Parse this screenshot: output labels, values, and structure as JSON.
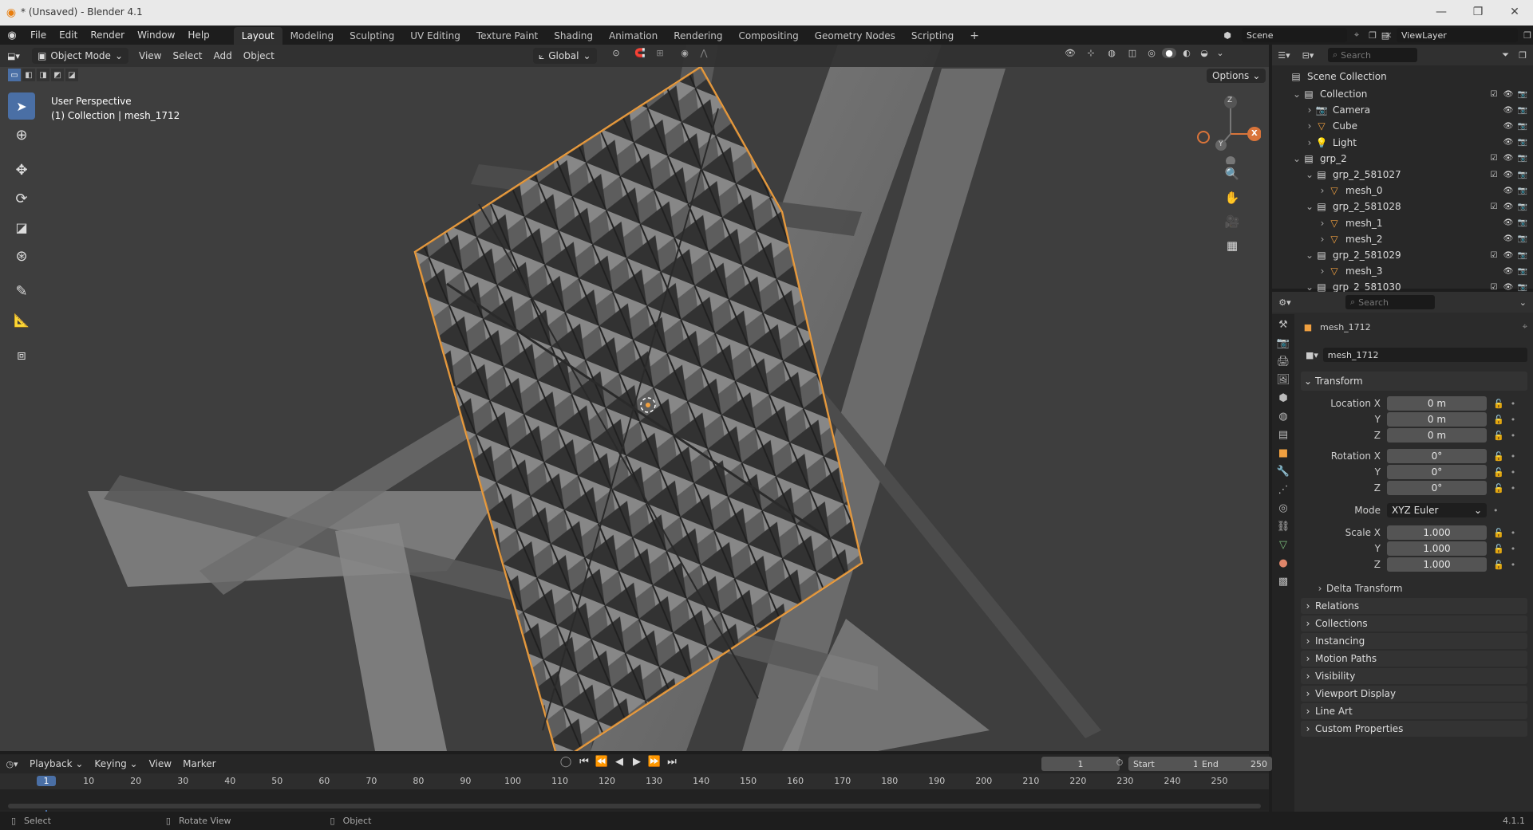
{
  "window": {
    "title": "* (Unsaved) - Blender 4.1"
  },
  "menu": [
    "File",
    "Edit",
    "Render",
    "Window",
    "Help"
  ],
  "workspaces": [
    {
      "label": "Layout",
      "active": true
    },
    {
      "label": "Modeling"
    },
    {
      "label": "Sculpting"
    },
    {
      "label": "UV Editing"
    },
    {
      "label": "Texture Paint"
    },
    {
      "label": "Shading"
    },
    {
      "label": "Animation"
    },
    {
      "label": "Rendering"
    },
    {
      "label": "Compositing"
    },
    {
      "label": "Geometry Nodes"
    },
    {
      "label": "Scripting"
    }
  ],
  "scene": {
    "name": "Scene",
    "view_layer": "ViewLayer"
  },
  "viewport": {
    "mode": "Object Mode",
    "menus": [
      "View",
      "Select",
      "Add",
      "Object"
    ],
    "transform_orientation": "Global",
    "options_label": "Options",
    "overlay_title": "User Perspective",
    "overlay_subtitle": "(1) Collection | mesh_1712",
    "gizmo_axes": {
      "z": "Z",
      "y": "Y",
      "x": "X"
    }
  },
  "outliner": {
    "search_placeholder": "Search",
    "root": "Scene Collection",
    "items": [
      {
        "label": "Collection",
        "depth": 1,
        "type": "collection"
      },
      {
        "label": "Camera",
        "depth": 2,
        "type": "camera"
      },
      {
        "label": "Cube",
        "depth": 2,
        "type": "mesh"
      },
      {
        "label": "Light",
        "depth": 2,
        "type": "light"
      },
      {
        "label": "grp_2",
        "depth": 1,
        "type": "collection"
      },
      {
        "label": "grp_2_581027",
        "depth": 2,
        "type": "collection"
      },
      {
        "label": "mesh_0",
        "depth": 3,
        "type": "mesh"
      },
      {
        "label": "grp_2_581028",
        "depth": 2,
        "type": "collection"
      },
      {
        "label": "mesh_1",
        "depth": 3,
        "type": "mesh"
      },
      {
        "label": "mesh_2",
        "depth": 3,
        "type": "mesh"
      },
      {
        "label": "grp_2_581029",
        "depth": 2,
        "type": "collection"
      },
      {
        "label": "mesh_3",
        "depth": 3,
        "type": "mesh"
      },
      {
        "label": "grp_2_581030",
        "depth": 2,
        "type": "collection"
      }
    ]
  },
  "properties": {
    "search_placeholder": "Search",
    "object_name": "mesh_1712",
    "transform_label": "Transform",
    "location_label": "Location X",
    "rotation_label": "Rotation X",
    "scale_label": "Scale X",
    "axis_y": "Y",
    "axis_z": "Z",
    "location": [
      "0 m",
      "0 m",
      "0 m"
    ],
    "rotation": [
      "0°",
      "0°",
      "0°"
    ],
    "mode_label": "Mode",
    "mode_value": "XYZ Euler",
    "scale": [
      "1.000",
      "1.000",
      "1.000"
    ],
    "delta_transform": "Delta Transform",
    "panels": [
      "Relations",
      "Collections",
      "Instancing",
      "Motion Paths",
      "Visibility",
      "Viewport Display",
      "Line Art",
      "Custom Properties"
    ]
  },
  "timeline": {
    "menus": [
      "Playback",
      "Keying",
      "View",
      "Marker"
    ],
    "current_frame": "1",
    "start_label": "Start",
    "start": "1",
    "end_label": "End",
    "end": "250",
    "ticks": [
      "1",
      "10",
      "20",
      "30",
      "40",
      "50",
      "60",
      "70",
      "80",
      "90",
      "100",
      "110",
      "120",
      "130",
      "140",
      "150",
      "160",
      "170",
      "180",
      "190",
      "200",
      "210",
      "220",
      "230",
      "240",
      "250"
    ]
  },
  "status": {
    "select": "Select",
    "rotate": "Rotate View",
    "object": "Object",
    "version": "4.1.1"
  },
  "colors": {
    "accent": "#4a6fa5",
    "selection": "#f0a040",
    "viewport_bg": "#3e3e3e"
  }
}
